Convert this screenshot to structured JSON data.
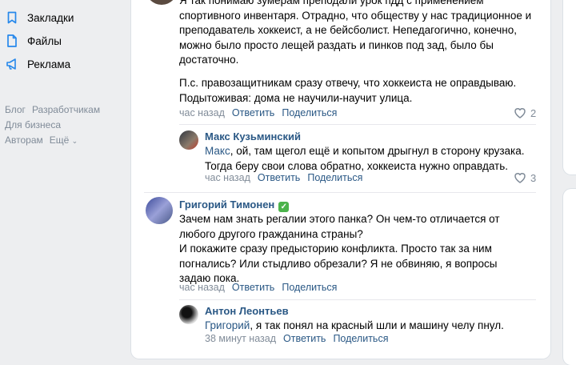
{
  "sidebar": {
    "items": [
      {
        "label": "Закладки",
        "icon": "bookmark-icon"
      },
      {
        "label": "Файлы",
        "icon": "file-icon"
      },
      {
        "label": "Реклама",
        "icon": "megaphone-icon"
      }
    ],
    "footer": {
      "blog": "Блог",
      "developers": "Разработчикам",
      "business": "Для бизнеса",
      "authors": "Авторам",
      "more": "Ещё"
    }
  },
  "comments": {
    "first": {
      "text_top": "Я так понимаю зумерам преподали урок пдд с применением спортивного инвентаря. Отрадно, что обществу у нас традиционное и преподаватель хоккеист, а не бейсболист. Непедагогично, конечно, можно было просто лещей раздать и пинков под зад, было бы достаточно.",
      "text_ps": "П.с. правозащитникам сразу отвечу, что хоккеиста не оправдываю. Подытоживая: дома не научили-научит улица.",
      "time": "час назад",
      "reply": "Ответить",
      "share": "Поделиться",
      "likes": "2"
    },
    "reply1": {
      "author": "Макс Кузьминский",
      "mention": "Макс",
      "text": ", ой, там щегол ещё и копытом дрыгнул в сторону крузака. Тогда беру свои слова обратно, хоккеиста нужно оправдать.",
      "time": "час назад",
      "reply": "Ответить",
      "share": "Поделиться",
      "likes": "3"
    },
    "second": {
      "author": "Григорий Тимонен",
      "verified": "✓",
      "text": "Зачем нам знать регалии этого панка? Он чем-то отличается от любого другого гражданина страны?\nИ покажите сразу предысторию конфликта. Просто так за ним погнались? Или стыдливо обрезали? Я не обвиняю, я вопросы задаю пока.",
      "time": "час назад",
      "reply": "Ответить",
      "share": "Поделиться"
    },
    "reply2": {
      "author": "Антон Леонтьев",
      "mention": "Григорий",
      "text": ", я так понял на красный шли и машину челу пнул.",
      "time": "38 минут назад",
      "reply": "Ответить",
      "share": "Поделиться"
    }
  },
  "colors": {
    "link": "#2a5885",
    "muted": "#818c99",
    "background": "#edeef0",
    "verified": "#4bb34b"
  }
}
